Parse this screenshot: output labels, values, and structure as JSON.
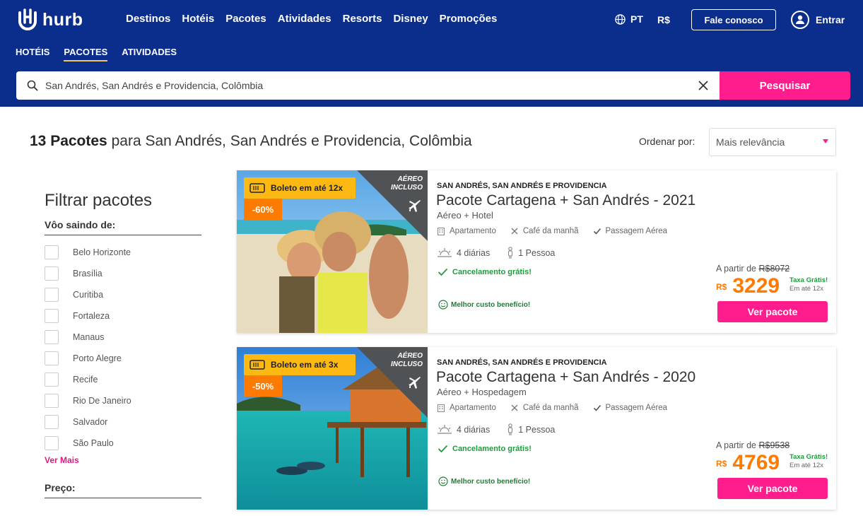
{
  "header": {
    "logo_text": "hurb",
    "nav": [
      "Destinos",
      "Hotéis",
      "Pacotes",
      "Atividades",
      "Resorts",
      "Disney",
      "Promoções"
    ],
    "language": "PT",
    "currency": "R$",
    "contact_label": "Fale conosco",
    "login_label": "Entrar",
    "subnav": [
      "HOTÉIS",
      "PACOTES",
      "ATIVIDADES"
    ],
    "subnav_active": "PACOTES",
    "colors": {
      "background": "#0B2E8C",
      "accent": "#FF1C8D",
      "underline": "#F5C85E"
    }
  },
  "search": {
    "value": "San Andrés, San Andrés e Providencia, Colômbia",
    "button_label": "Pesquisar"
  },
  "results": {
    "count_label": "13 Pacotes",
    "for_label": "para San Andrés, San Andrés e Providencia, Colômbia",
    "sort_label": "Ordenar por:",
    "sort_value": "Mais relevância"
  },
  "filters": {
    "title": "Filtrar pacotes",
    "departure_label": "Vôo saindo de:",
    "cities": [
      "Belo Horizonte",
      "Brasília",
      "Curitiba",
      "Fortaleza",
      "Manaus",
      "Porto Alegre",
      "Recife",
      "Rio De Janeiro",
      "Salvador",
      "São Paulo"
    ],
    "see_more": "Ver Mais",
    "price_label": "Preço:"
  },
  "packages": [
    {
      "boleto": "Boleto em até 12x",
      "discount": "-60%",
      "aereo_line1": "AÉREO",
      "aereo_line2": "INCLUSO",
      "location": "SAN ANDRÉS, SAN ANDRÉS E PROVIDENCIA",
      "title": "Pacote Cartagena + San Andrés - 2021",
      "type": "Aéreo + Hotel",
      "amenities": [
        "Apartamento",
        "Café da manhã",
        "Passagem Aérea"
      ],
      "diarias": "4 diárias",
      "pessoas": "1 Pessoa",
      "cancel": "Cancelamento grátis!",
      "best": "Melhor custo benefício!",
      "from_label": "A partir de",
      "old_price": "R$8072",
      "currency": "R$",
      "price": "3229",
      "taxa": "Taxa Grátis!",
      "installments": "Em até 12x",
      "button": "Ver pacote"
    },
    {
      "boleto": "Boleto em até 3x",
      "discount": "-50%",
      "aereo_line1": "AÉREO",
      "aereo_line2": "INCLUSO",
      "location": "SAN ANDRÉS, SAN ANDRÉS E PROVIDENCIA",
      "title": "Pacote Cartagena + San Andrés - 2020",
      "type": "Aéreo + Hospedagem",
      "amenities": [
        "Apartamento",
        "Café da manhã",
        "Passagem Aérea"
      ],
      "diarias": "4 diárias",
      "pessoas": "1 Pessoa",
      "cancel": "Cancelamento grátis!",
      "best": "Melhor custo benefício!",
      "from_label": "A partir de",
      "old_price": "R$9538",
      "currency": "R$",
      "price": "4769",
      "taxa": "Taxa Grátis!",
      "installments": "Em até 12x",
      "button": "Ver pacote"
    }
  ]
}
